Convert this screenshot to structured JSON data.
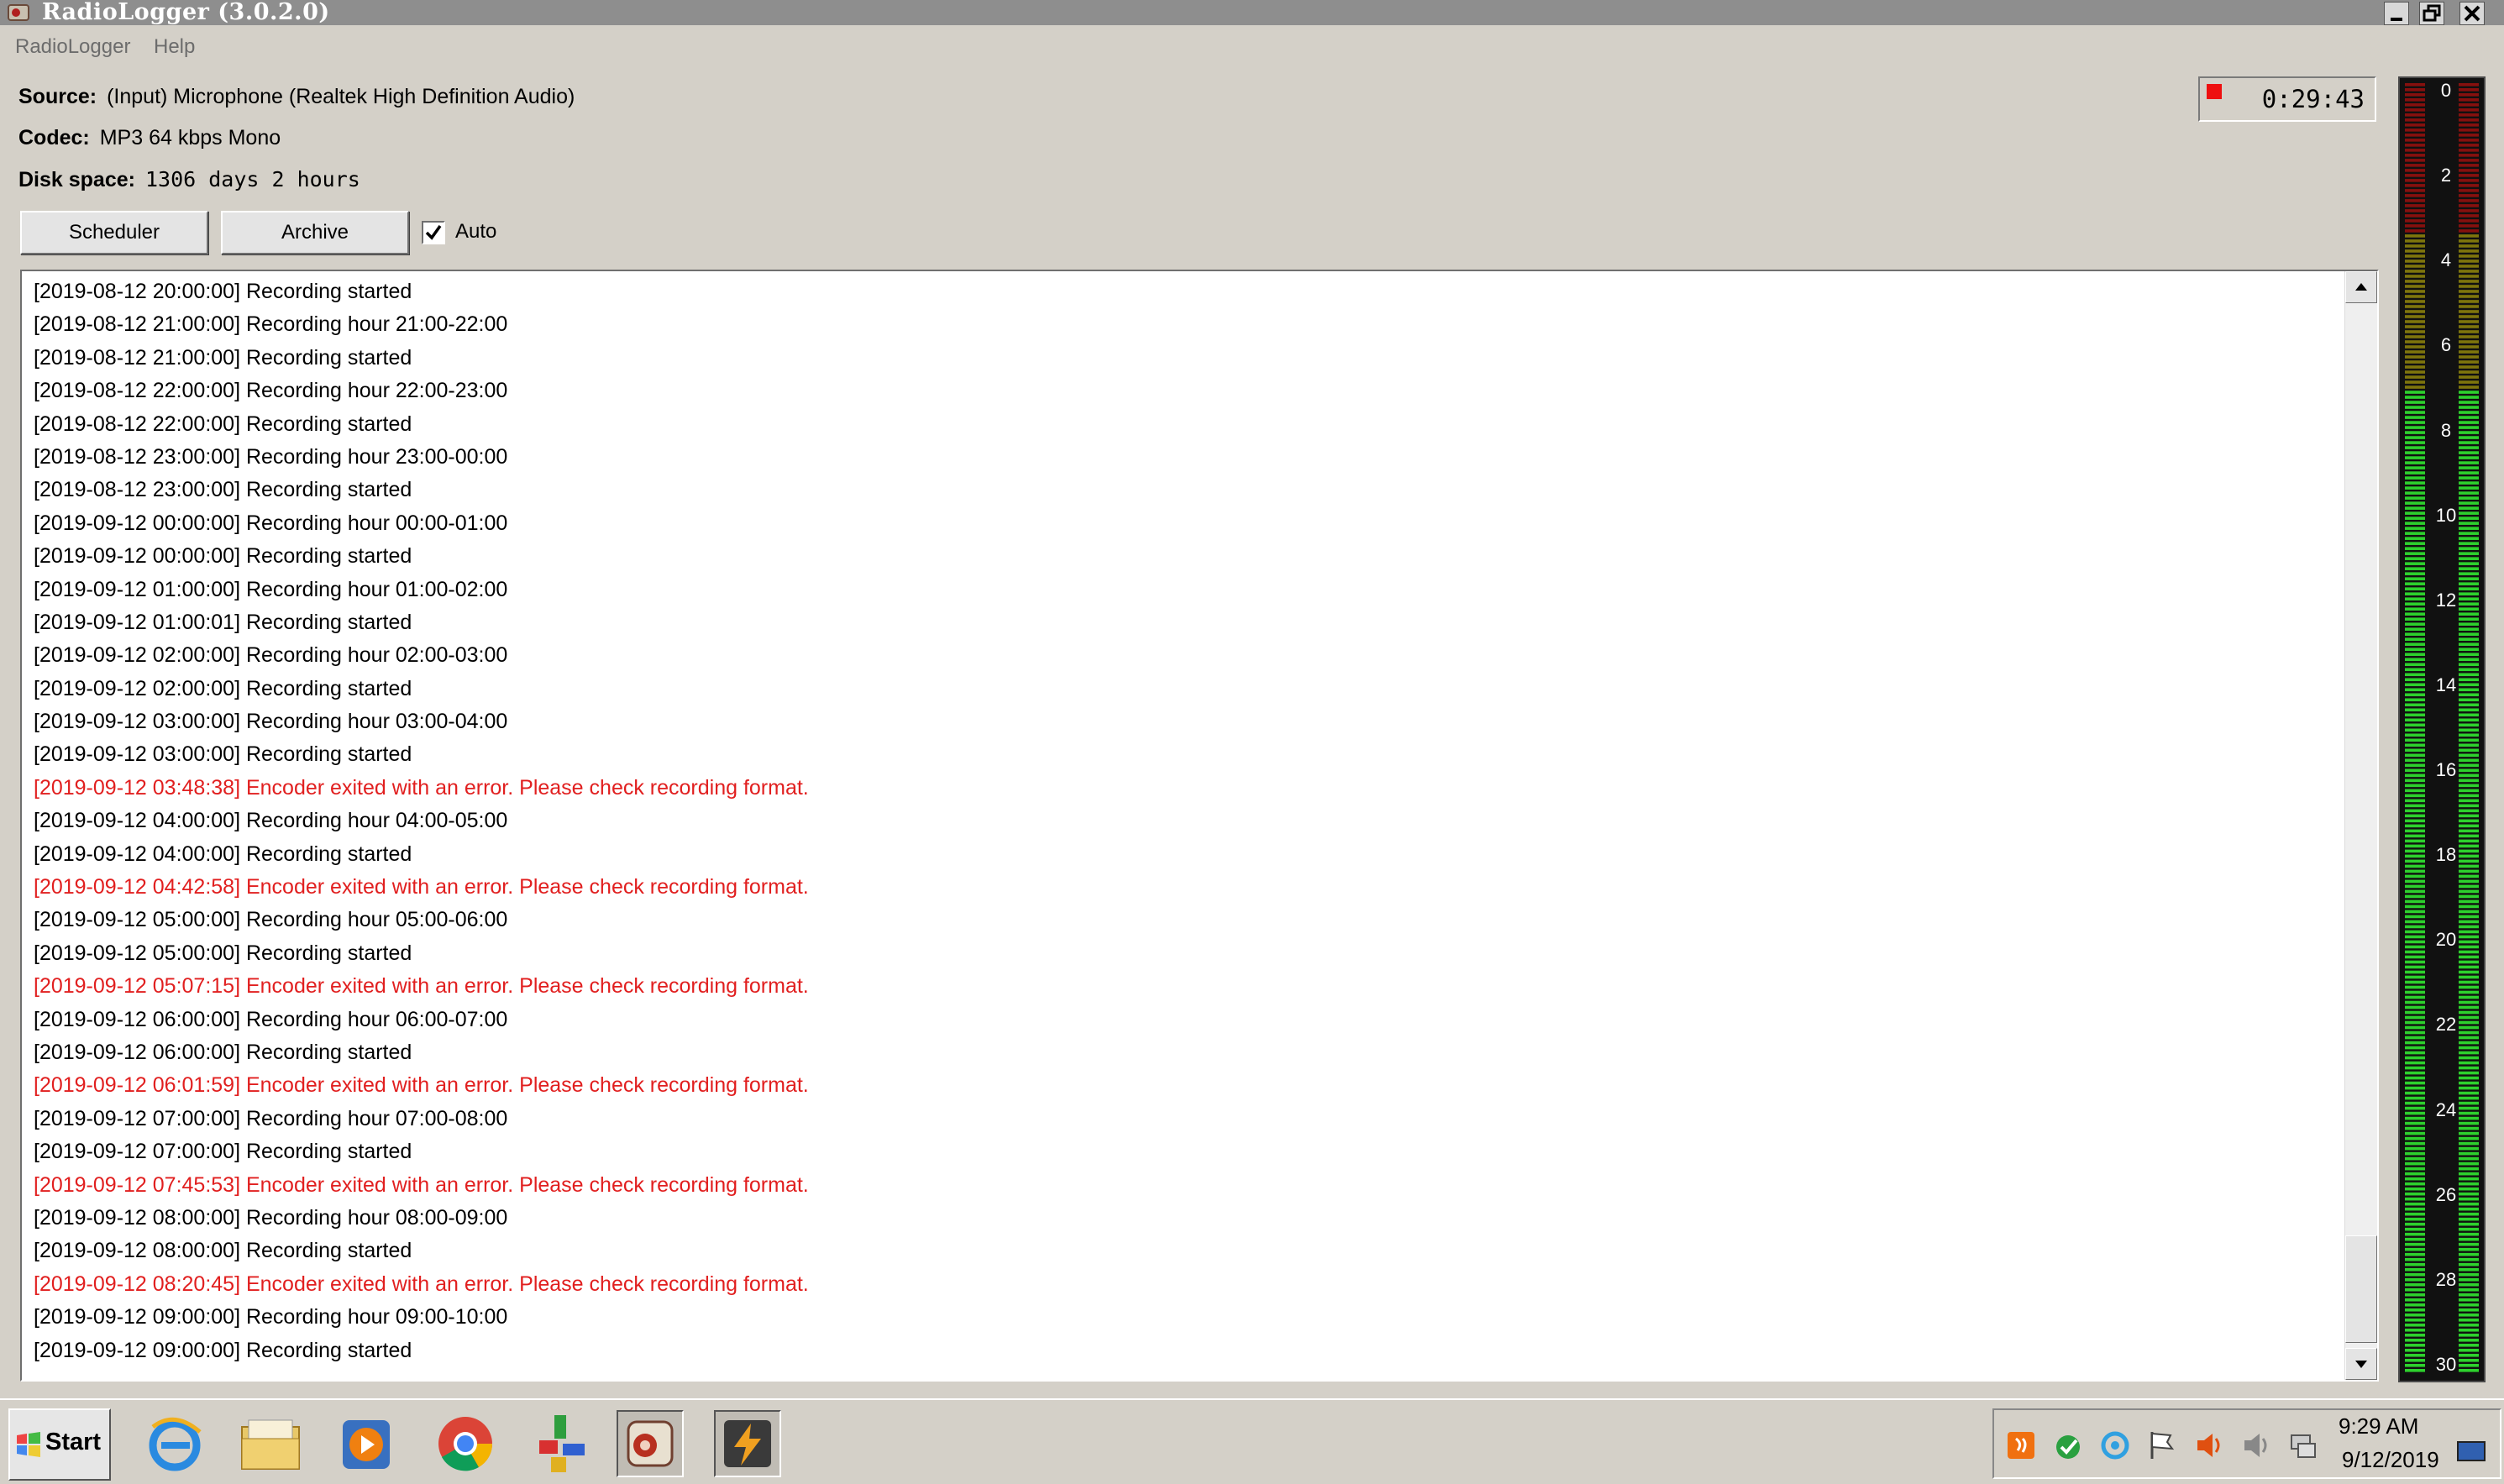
{
  "window": {
    "title": "RadioLogger (3.0.2.0)"
  },
  "menu": [
    "RadioLogger",
    "Help"
  ],
  "info": {
    "source_label": "Source:",
    "source_value": "(Input) Microphone (Realtek High Definition Audio)",
    "codec_label": "Codec:",
    "codec_value": "MP3 64 kbps Mono",
    "disk_label": "Disk space:",
    "disk_value": "1306 days 2 hours"
  },
  "toolbar": {
    "scheduler_label": "Scheduler",
    "archive_label": "Archive",
    "auto_label": "Auto",
    "auto_checked": true
  },
  "timer": {
    "value": "0:29:43"
  },
  "log": {
    "error_color": "#e11f1f",
    "lines": [
      {
        "text": "[2019-08-12 20:00:00] Recording started",
        "error": false
      },
      {
        "text": "[2019-08-12 21:00:00] Recording hour 21:00-22:00",
        "error": false
      },
      {
        "text": "[2019-08-12 21:00:00] Recording started",
        "error": false
      },
      {
        "text": "[2019-08-12 22:00:00] Recording hour 22:00-23:00",
        "error": false
      },
      {
        "text": "[2019-08-12 22:00:00] Recording started",
        "error": false
      },
      {
        "text": "[2019-08-12 23:00:00] Recording hour 23:00-00:00",
        "error": false
      },
      {
        "text": "[2019-08-12 23:00:00] Recording started",
        "error": false
      },
      {
        "text": "[2019-09-12 00:00:00] Recording hour 00:00-01:00",
        "error": false
      },
      {
        "text": "[2019-09-12 00:00:00] Recording started",
        "error": false
      },
      {
        "text": "[2019-09-12 01:00:00] Recording hour 01:00-02:00",
        "error": false
      },
      {
        "text": "[2019-09-12 01:00:01] Recording started",
        "error": false
      },
      {
        "text": "[2019-09-12 02:00:00] Recording hour 02:00-03:00",
        "error": false
      },
      {
        "text": "[2019-09-12 02:00:00] Recording started",
        "error": false
      },
      {
        "text": "[2019-09-12 03:00:00] Recording hour 03:00-04:00",
        "error": false
      },
      {
        "text": "[2019-09-12 03:00:00] Recording started",
        "error": false
      },
      {
        "text": "[2019-09-12 03:48:38] Encoder exited with an error. Please check recording format.",
        "error": true
      },
      {
        "text": "[2019-09-12 04:00:00] Recording hour 04:00-05:00",
        "error": false
      },
      {
        "text": "[2019-09-12 04:00:00] Recording started",
        "error": false
      },
      {
        "text": "[2019-09-12 04:42:58] Encoder exited with an error. Please check recording format.",
        "error": true
      },
      {
        "text": "[2019-09-12 05:00:00] Recording hour 05:00-06:00",
        "error": false
      },
      {
        "text": "[2019-09-12 05:00:00] Recording started",
        "error": false
      },
      {
        "text": "[2019-09-12 05:07:15] Encoder exited with an error. Please check recording format.",
        "error": true
      },
      {
        "text": "[2019-09-12 06:00:00] Recording hour 06:00-07:00",
        "error": false
      },
      {
        "text": "[2019-09-12 06:00:00] Recording started",
        "error": false
      },
      {
        "text": "[2019-09-12 06:01:59] Encoder exited with an error. Please check recording format.",
        "error": true
      },
      {
        "text": "[2019-09-12 07:00:00] Recording hour 07:00-08:00",
        "error": false
      },
      {
        "text": "[2019-09-12 07:00:00] Recording started",
        "error": false
      },
      {
        "text": "[2019-09-12 07:45:53] Encoder exited with an error. Please check recording format.",
        "error": true
      },
      {
        "text": "[2019-09-12 08:00:00] Recording hour 08:00-09:00",
        "error": false
      },
      {
        "text": "[2019-09-12 08:00:00] Recording started",
        "error": false
      },
      {
        "text": "[2019-09-12 08:20:45] Encoder exited with an error. Please check recording format.",
        "error": true
      },
      {
        "text": "[2019-09-12 09:00:00] Recording hour 09:00-10:00",
        "error": false
      },
      {
        "text": "[2019-09-12 09:00:00] Recording started",
        "error": false
      }
    ]
  },
  "meter": {
    "scale_labels": [
      "0",
      "2",
      "4",
      "6",
      "8",
      "10",
      "12",
      "14",
      "16",
      "18",
      "20",
      "22",
      "24",
      "26",
      "28",
      "30"
    ],
    "level_fraction": 0.0,
    "colors": {
      "red": "#e8100c",
      "yellow": "#d8c80a",
      "green": "#2dd12d",
      "off": "#3a1a1a"
    }
  },
  "taskbar": {
    "start_label": "Start",
    "apps": [
      "internet-explorer-icon",
      "file-explorer-icon",
      "media-player-icon",
      "chrome-icon",
      "network-app-icon",
      "radiologger-app-icon",
      "winamp-icon"
    ],
    "tray_icons": [
      "java-icon",
      "sync-icon",
      "security-icon",
      "action-center-flag-icon",
      "volume-icon",
      "volume-2-icon",
      "network-icon"
    ],
    "clock_time": "9:29 AM",
    "clock_date": "9/12/2019"
  }
}
